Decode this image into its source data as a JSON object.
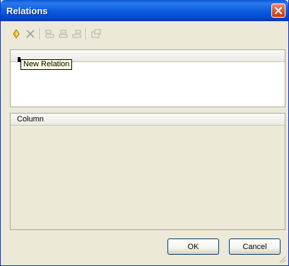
{
  "window": {
    "title": "Relations"
  },
  "toolbar": {
    "buttons": [
      {
        "icon": "new-relation-icon"
      },
      {
        "icon": "delete-icon"
      },
      {
        "icon": "align-left-icon"
      },
      {
        "icon": "align-center-icon"
      },
      {
        "icon": "align-right-icon"
      },
      {
        "icon": "properties-icon"
      }
    ]
  },
  "relations_panel": {
    "header": ""
  },
  "tooltip": {
    "text": "New Relation"
  },
  "column_panel": {
    "header": "Column"
  },
  "buttons": {
    "ok": "OK",
    "cancel": "Cancel"
  },
  "colors": {
    "title_bar": "#0b5fe0",
    "close_button": "#e0542a",
    "dialog_background": "#ece9d8",
    "tooltip_background": "#ffffe1"
  }
}
